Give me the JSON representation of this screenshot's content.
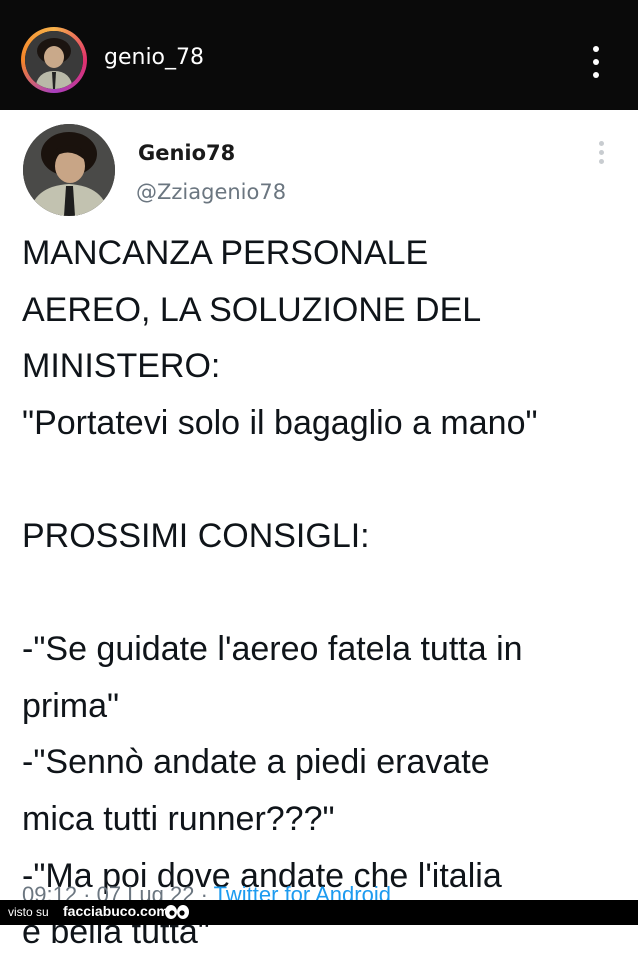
{
  "header": {
    "username": "genio_78",
    "menu_icon": "vertical-ellipsis-icon"
  },
  "tweet": {
    "display_name": "Genio78",
    "handle": "@Zziagenio78",
    "menu_icon": "vertical-ellipsis-icon",
    "lines": [
      "MANCANZA PERSONALE",
      "AEREO, LA SOLUZIONE DEL",
      "MINISTERO:",
      "\"Portatevi solo il bagaglio a mano\"",
      "",
      "PROSSIMI CONSIGLI:",
      "",
      "-\"Se guidate l'aereo fatela tutta in",
      "prima\"",
      "-\"Sennò andate a piedi eravate",
      "mica tutti runner???\"",
      "-\"Ma poi dove andate che l'italia",
      "è bella tutta\""
    ],
    "meta_time": "09:12 · 07 Lug 22 ·",
    "meta_source": "Twitter for Android"
  },
  "footer": {
    "visto_su": "visto su",
    "site": "facciabuco.com"
  },
  "colors": {
    "topbar_bg": "#0a0a0a",
    "text": "#0f1419",
    "secondary": "#6b7680",
    "link": "#1d9bf0"
  }
}
